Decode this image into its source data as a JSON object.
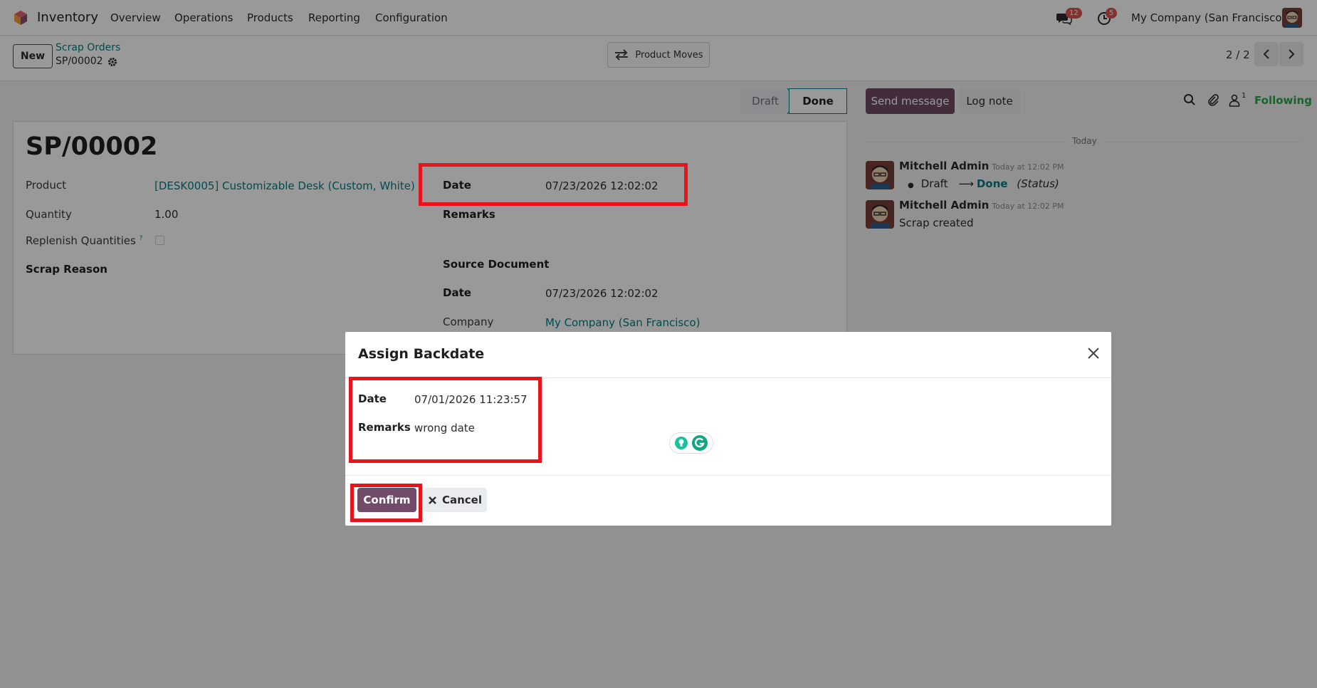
{
  "navbar": {
    "app_name": "Inventory",
    "menu": [
      "Overview",
      "Operations",
      "Products",
      "Reporting",
      "Configuration"
    ],
    "messages_count": "12",
    "activities_count": "5",
    "company": "My Company (San Francisco)"
  },
  "control": {
    "new_label": "New",
    "breadcrumb_parent": "Scrap Orders",
    "breadcrumb_current": "SP/00002",
    "product_moves_label": "Product Moves",
    "pager": "2 / 2"
  },
  "status": {
    "draft": "Draft",
    "done": "Done"
  },
  "form": {
    "title": "SP/00002",
    "product_label": "Product",
    "product_value": "[DESK0005] Customizable Desk (Custom, White)",
    "quantity_label": "Quantity",
    "quantity_value": "1.00",
    "replenish_label": "Replenish Quantities",
    "replenish_help": "?",
    "scrap_reason_label": "Scrap Reason",
    "date_label": "Date",
    "date_value": "07/23/2026 12:02:02",
    "remarks_label": "Remarks",
    "source_document_label": "Source Document",
    "date2_label": "Date",
    "date2_value": "07/23/2026 12:02:02",
    "company_label": "Company",
    "company_value": "My Company (San Francisco)"
  },
  "chatter": {
    "send_message": "Send message",
    "log_note": "Log note",
    "followers_count": "1",
    "following": "Following",
    "today": "Today",
    "messages": [
      {
        "author": "Mitchell Admin",
        "time": "Today at 12:02 PM",
        "from": "Draft",
        "to": "Done",
        "field": "(Status)"
      },
      {
        "author": "Mitchell Admin",
        "time": "Today at 12:02 PM",
        "body": "Scrap created"
      }
    ]
  },
  "modal": {
    "title": "Assign Backdate",
    "date_label": "Date",
    "date_value": "07/01/2026 11:23:57",
    "remarks_label": "Remarks",
    "remarks_value": "wrong date",
    "confirm_label": "Confirm",
    "cancel_label": "Cancel"
  },
  "colors": {
    "primary": "#714b67",
    "link": "#017e84",
    "highlight": "#e8141b"
  }
}
